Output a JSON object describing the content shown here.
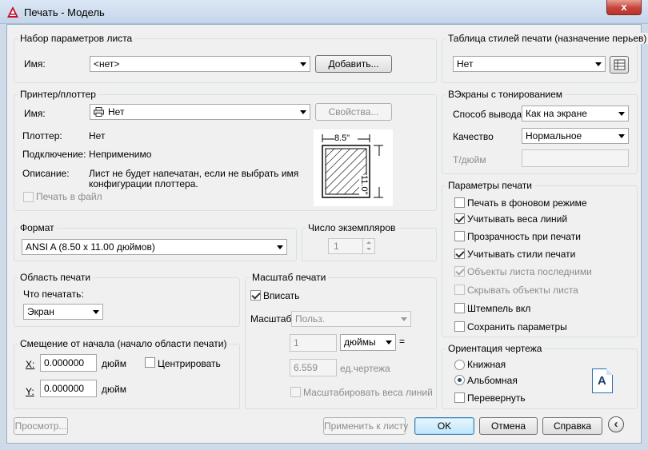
{
  "window": {
    "title": "Печать - Модель",
    "close_glyph": "x"
  },
  "page_setup": {
    "group_label": "Набор параметров листа",
    "name_label": "Имя:",
    "name_value": "<нет>",
    "add_button": "Добавить..."
  },
  "printer": {
    "group_label": "Принтер/плоттер",
    "name_label": "Имя:",
    "name_value": "Нет",
    "properties_button": "Свойства...",
    "plotter_label": "Плоттер:",
    "plotter_value": "Нет",
    "connection_label": "Подключение:",
    "connection_value": "Неприменимо",
    "description_label": "Описание:",
    "description_line1": "Лист не будет напечатан, если не выбрать имя",
    "description_line2": "конфигурации плоттера.",
    "print_to_file": "Печать в файл",
    "preview_width": "8.5\"",
    "preview_height": "11.0\""
  },
  "paper_size": {
    "group_label": "Формат",
    "value": "ANSI A (8.50 x 11.00 дюймов)"
  },
  "copies": {
    "group_label": "Число экземпляров",
    "value": "1"
  },
  "plot_area": {
    "group_label": "Область печати",
    "what_label": "Что печатать:",
    "what_value": "Экран"
  },
  "plot_offset": {
    "group_label": "Смещение от начала (начало области печати)",
    "x_label": "X:",
    "x_value": "0.000000",
    "x_unit": "дюйм",
    "y_label": "Y:",
    "y_value": "0.000000",
    "y_unit": "дюйм",
    "center_label": "Центрировать"
  },
  "plot_scale": {
    "group_label": "Масштаб печати",
    "fit_label": "Вписать",
    "scale_label": "Масштаб:",
    "scale_value": "Польз.",
    "value1": "1",
    "unit_value": "дюймы",
    "equals": "=",
    "value2": "6.559",
    "unit2": "ед.чертежа",
    "scale_lineweights": "Масштабировать веса линий"
  },
  "plot_style": {
    "group_label": "Таблица стилей печати (назначение перьев)",
    "value": "Нет"
  },
  "shaded": {
    "group_label": "ВЭкраны с тонированием",
    "output_label": "Способ вывода",
    "output_value": "Как на экране",
    "quality_label": "Качество",
    "quality_value": "Нормальное",
    "dpi_label": "Т/дюйм"
  },
  "plot_options": {
    "group_label": "Параметры печати",
    "items": [
      {
        "label": "Печать в фоновом режиме"
      },
      {
        "label": "Учитывать веса линий"
      },
      {
        "label": "Прозрачность при печати"
      },
      {
        "label": "Учитывать стили печати"
      },
      {
        "label": "Объекты листа последними"
      },
      {
        "label": "Скрывать объекты листа"
      },
      {
        "label": "Штемпель вкл"
      },
      {
        "label": "Сохранить параметры"
      }
    ]
  },
  "orientation": {
    "group_label": "Ориентация чертежа",
    "portrait": "Книжная",
    "landscape": "Альбомная",
    "upside_down": "Перевернуть",
    "icon_letter": "A"
  },
  "buttons": {
    "preview": "Просмотр...",
    "apply": "Применить к листу",
    "ok": "OK",
    "cancel": "Отмена",
    "help": "Справка",
    "collapse_glyph": "‹"
  }
}
